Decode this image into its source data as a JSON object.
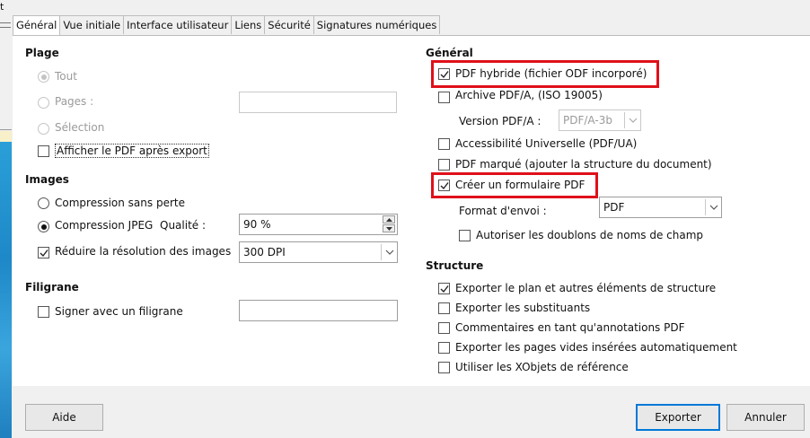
{
  "window_edge_text": "t",
  "tabs": [
    "Général",
    "Vue initiale",
    "Interface utilisateur",
    "Liens",
    "Sécurité",
    "Signatures numériques"
  ],
  "plage": {
    "title": "Plage",
    "tout": "Tout",
    "pages": "Pages :",
    "selection": "Sélection",
    "afficher_pdf": "Afficher le PDF après export"
  },
  "images": {
    "title": "Images",
    "sans_perte": "Compression sans perte",
    "jpeg": "Compression JPEG",
    "qualite": "Qualité :",
    "qualite_value": "90 %",
    "reduire": "Réduire la résolution des images",
    "resolution_value": "300 DPI"
  },
  "filigrane": {
    "title": "Filigrane",
    "signer": "Signer avec un filigrane"
  },
  "general": {
    "title": "Général",
    "pdf_hybride": "PDF hybride (fichier ODF incorporé)",
    "archive": "Archive PDF/A, (ISO 19005)",
    "version_label": "Version PDF/A :",
    "version_value": "PDF/A-3b",
    "accessibilite": "Accessibilité Universelle (PDF/UA)",
    "pdf_marque": "PDF marqué (ajouter la structure du document)",
    "creer_formulaire": "Créer un formulaire PDF",
    "format_envoi": "Format d'envoi :",
    "format_value": "PDF",
    "autoriser_doublons": "Autoriser les doublons de noms de champ"
  },
  "structure": {
    "title": "Structure",
    "exporter_plan": "Exporter le plan et autres éléments de structure",
    "exporter_substituants": "Exporter les substituants",
    "commentaires": "Commentaires en tant qu'annotations PDF",
    "pages_vides": "Exporter les pages vides insérées automatiquement",
    "xobjets": "Utiliser les XObjets de référence"
  },
  "buttons": {
    "aide": "Aide",
    "exporter": "Exporter",
    "annuler": "Annuler"
  },
  "colors": {
    "highlight": "#e0101a",
    "primary_border": "#0078d7",
    "desktop_blue": "#2a9fd8"
  }
}
